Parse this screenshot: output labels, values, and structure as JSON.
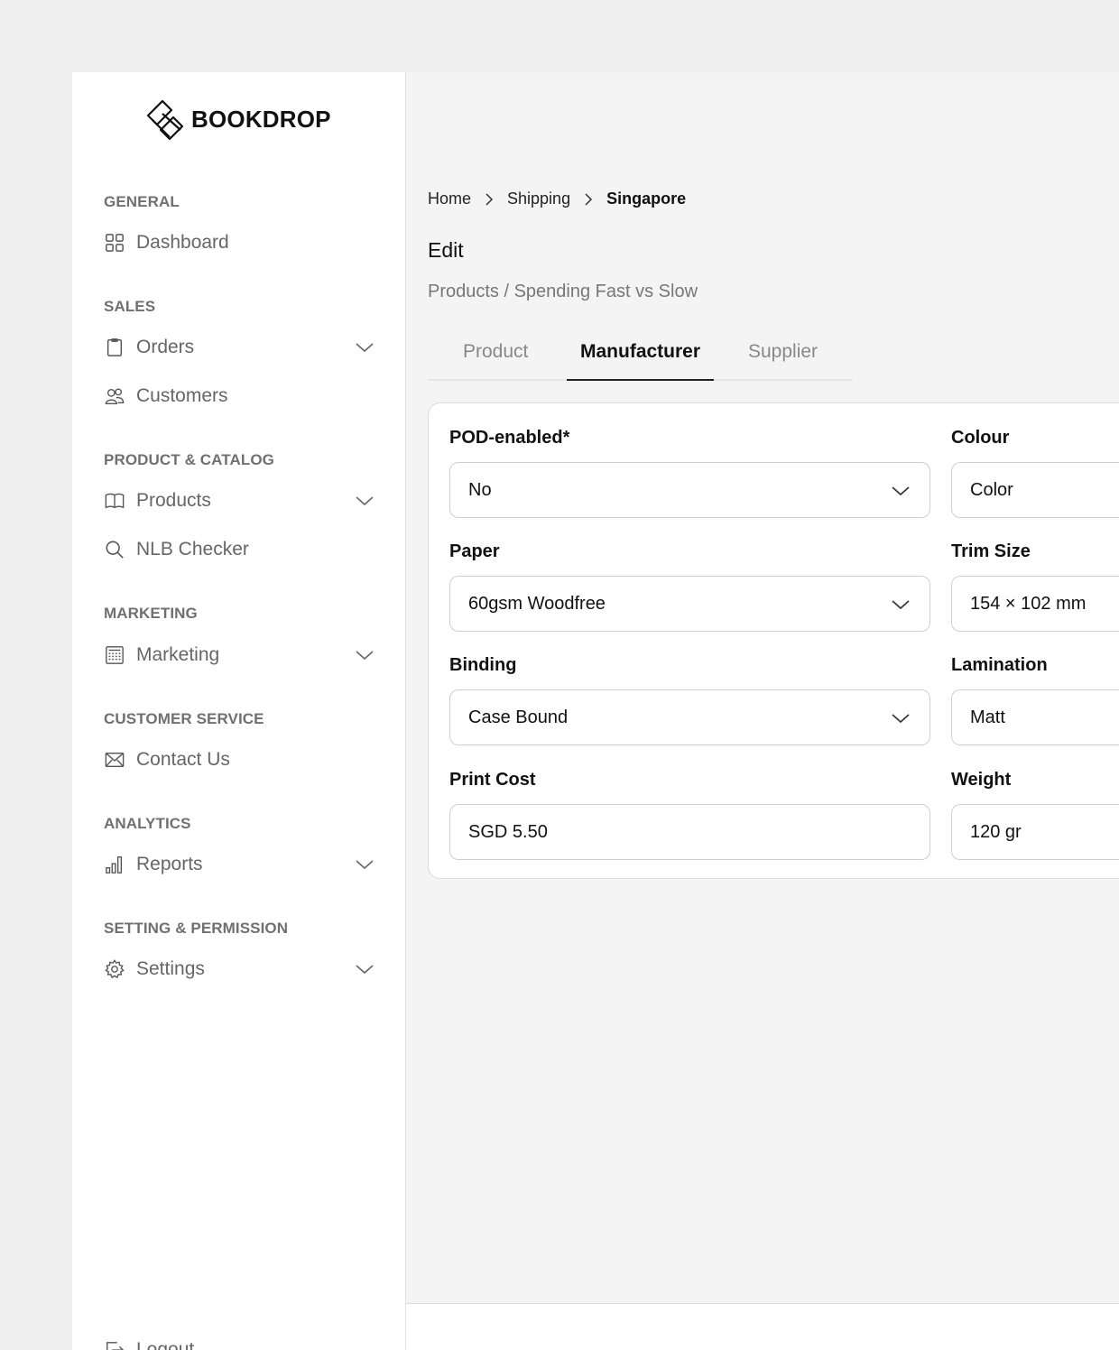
{
  "brand": {
    "name": "BOOKDROP"
  },
  "sidebar": {
    "sections": [
      {
        "title": "GENERAL",
        "items": [
          {
            "label": "Dashboard",
            "icon": "grid-icon",
            "expandable": false
          }
        ]
      },
      {
        "title": "SALES",
        "items": [
          {
            "label": "Orders",
            "icon": "clipboard-icon",
            "expandable": true
          },
          {
            "label": "Customers",
            "icon": "users-icon",
            "expandable": false
          }
        ]
      },
      {
        "title": "PRODUCT & CATALOG",
        "items": [
          {
            "label": "Products",
            "icon": "book-icon",
            "expandable": true
          },
          {
            "label": "NLB Checker",
            "icon": "search-icon",
            "expandable": false
          }
        ]
      },
      {
        "title": "MARKETING",
        "items": [
          {
            "label": "Marketing",
            "icon": "calculator-icon",
            "expandable": true
          }
        ]
      },
      {
        "title": "CUSTOMER SERVICE",
        "items": [
          {
            "label": "Contact Us",
            "icon": "mail-icon",
            "expandable": false
          }
        ]
      },
      {
        "title": "ANALYTICS",
        "items": [
          {
            "label": "Reports",
            "icon": "bar-chart-icon",
            "expandable": true
          }
        ]
      },
      {
        "title": "SETTING & PERMISSION",
        "items": [
          {
            "label": "Settings",
            "icon": "gear-icon",
            "expandable": true
          }
        ]
      }
    ],
    "logout": {
      "label": "Logout",
      "icon": "logout-icon"
    }
  },
  "breadcrumb": {
    "items": [
      "Home",
      "Shipping"
    ],
    "current": "Singapore"
  },
  "page": {
    "title": "Edit",
    "subtitle": "Products / Spending Fast vs Slow"
  },
  "tabs": {
    "items": [
      "Product",
      "Manufacturer",
      "Supplier"
    ],
    "active": "Manufacturer"
  },
  "form": {
    "pod_enabled": {
      "label": "POD-enabled*",
      "value": "No"
    },
    "colour": {
      "label": "Colour",
      "value": "Color"
    },
    "paper": {
      "label": "Paper",
      "value": "60gsm Woodfree"
    },
    "trim_size": {
      "label": "Trim Size",
      "value": "154 × 102 mm"
    },
    "binding": {
      "label": "Binding",
      "value": "Case Bound"
    },
    "lamination": {
      "label": "Lamination",
      "value": "Matt"
    },
    "print_cost": {
      "label": "Print Cost",
      "value": "SGD 5.50"
    },
    "weight": {
      "label": "Weight",
      "value": "120 gr"
    }
  }
}
